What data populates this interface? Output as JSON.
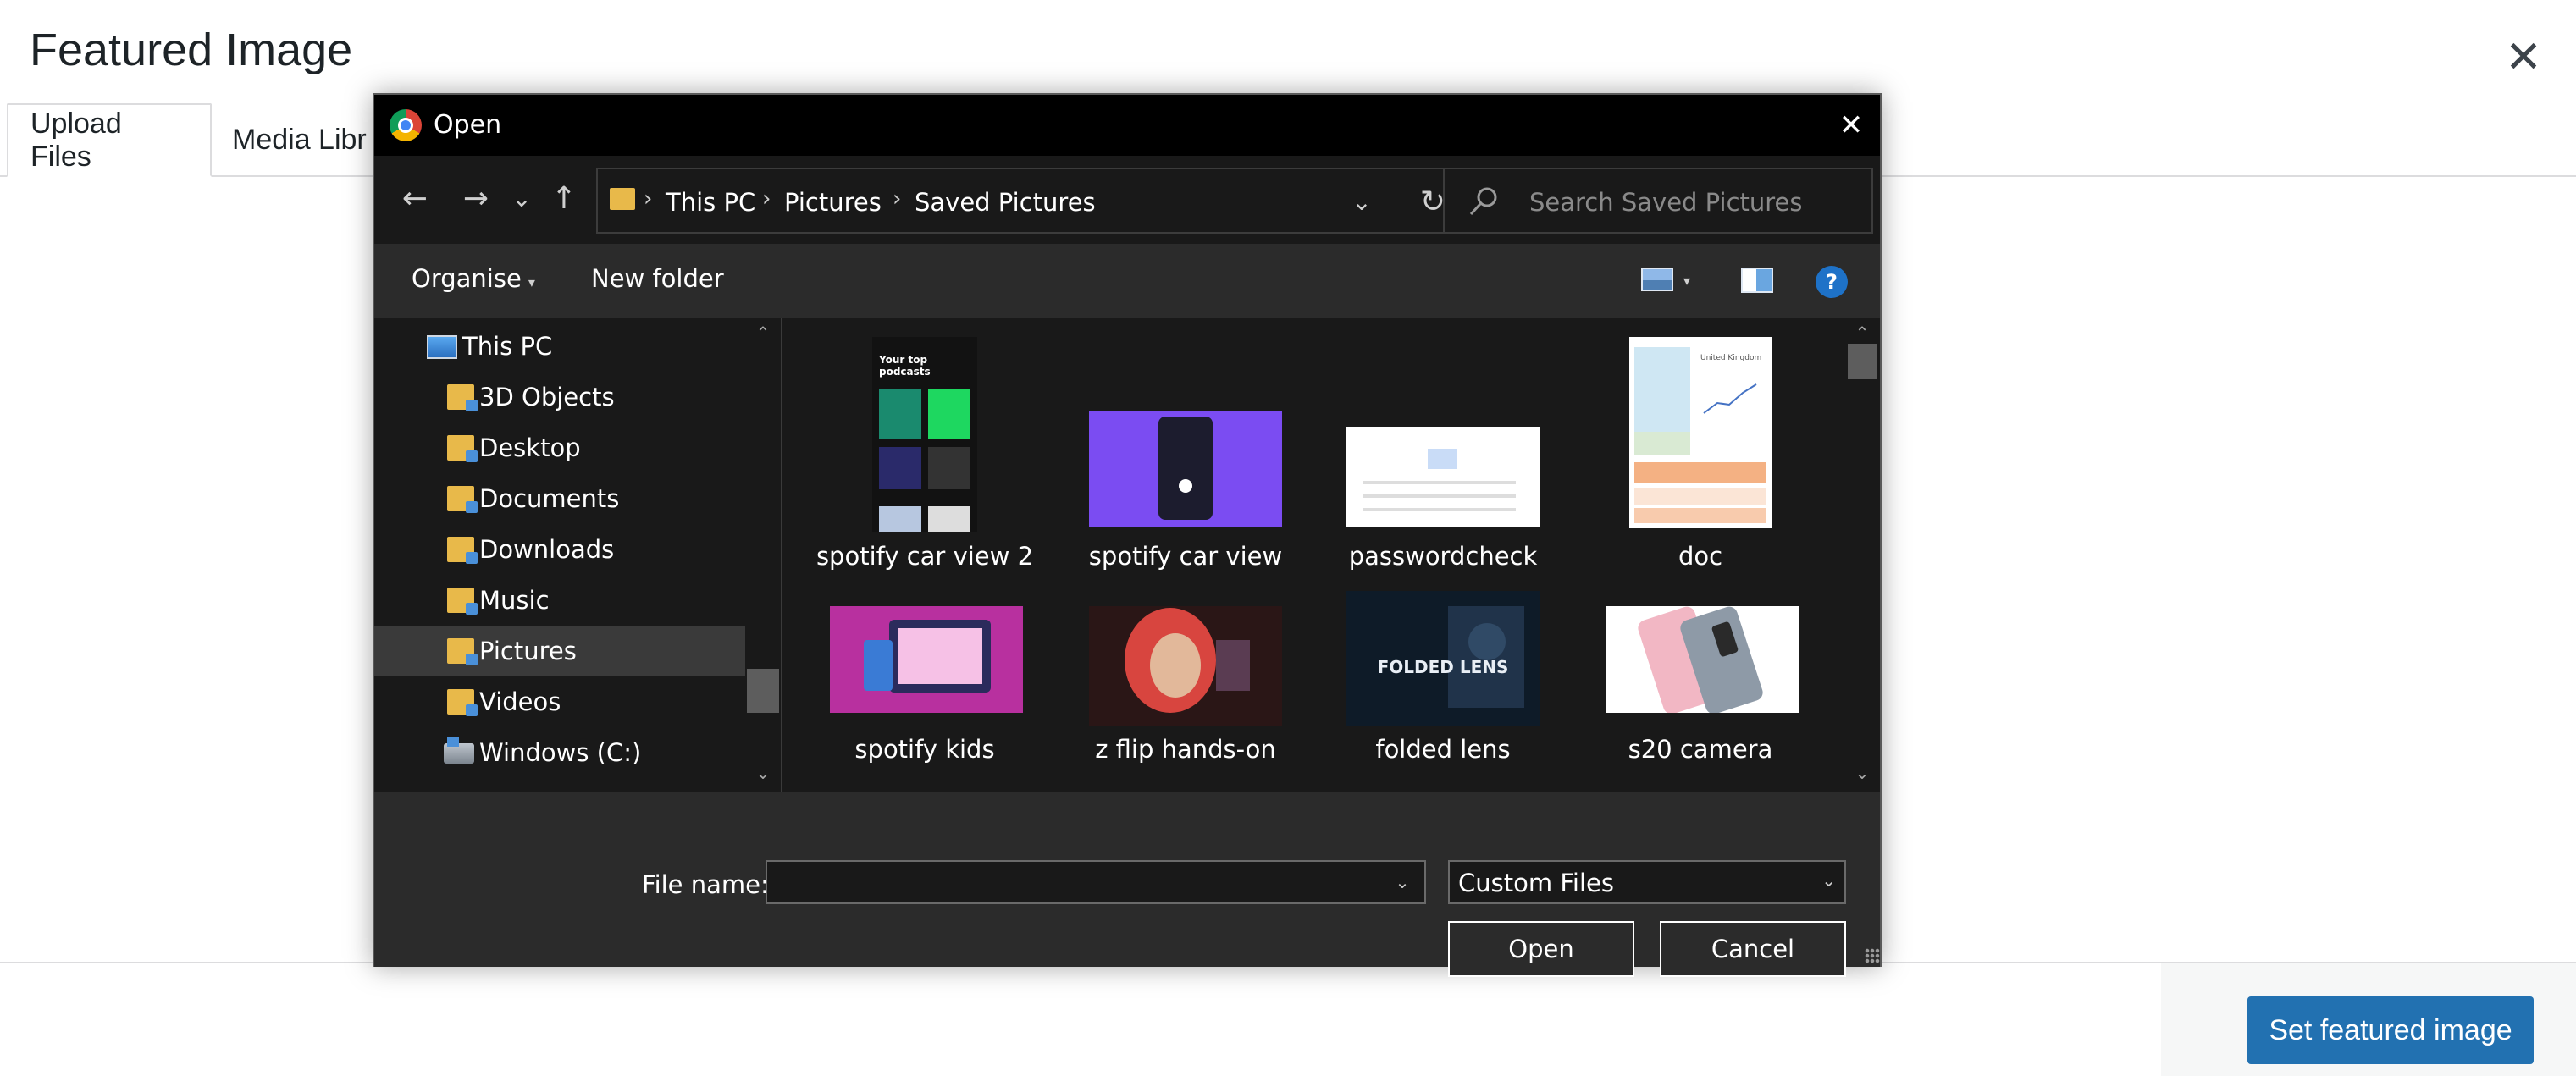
{
  "wp_modal": {
    "title": "Featured Image",
    "close_glyph": "✕",
    "tabs": [
      {
        "label": "Upload Files",
        "active": true
      },
      {
        "label": "Media Libr"
      }
    ],
    "primary_button": "Set featured image",
    "accent_color": "#2271b1"
  },
  "dialog": {
    "title": "Open",
    "app_icon": "chrome-icon",
    "close_glyph": "✕",
    "nav": {
      "back_glyph": "←",
      "forward_glyph": "→",
      "recent_glyph": "⌄",
      "up_glyph": "↑",
      "breadcrumbs": [
        "This PC",
        "Pictures",
        "Saved Pictures"
      ],
      "separator_glyph": "›",
      "dropdown_glyph": "⌄",
      "refresh_glyph": "↻"
    },
    "search": {
      "placeholder": "Search Saved Pictures"
    },
    "toolbar": {
      "organise": "Organise",
      "new_folder": "New folder",
      "caret_glyph": "▾",
      "help_glyph": "?"
    },
    "tree": [
      {
        "label": "This PC",
        "icon": "computer-icon"
      },
      {
        "label": "3D Objects",
        "icon": "folder-icon"
      },
      {
        "label": "Desktop",
        "icon": "folder-icon"
      },
      {
        "label": "Documents",
        "icon": "folder-icon"
      },
      {
        "label": "Downloads",
        "icon": "folder-icon"
      },
      {
        "label": "Music",
        "icon": "folder-icon"
      },
      {
        "label": "Pictures",
        "icon": "folder-icon",
        "selected": true
      },
      {
        "label": "Videos",
        "icon": "folder-icon"
      },
      {
        "label": "Windows (C:)",
        "icon": "drive-icon"
      }
    ],
    "files": [
      {
        "name": "spotify car view 2",
        "thumb_text": "Your top podcasts"
      },
      {
        "name": "spotify car view"
      },
      {
        "name": "passwordcheck"
      },
      {
        "name": "doc",
        "thumb_text": "United Kingdom"
      },
      {
        "name": "spotify kids"
      },
      {
        "name": "z flip hands-on"
      },
      {
        "name": "folded lens",
        "thumb_text": "FOLDED LENS"
      },
      {
        "name": "s20 camera"
      }
    ],
    "scroll_up_glyph": "⌃",
    "scroll_down_glyph": "⌄",
    "file_name_label": "File name:",
    "file_name_value": "",
    "file_name_caret": "⌄",
    "file_type": "Custom Files",
    "file_type_caret": "⌄",
    "open_button": "Open",
    "cancel_button": "Cancel"
  }
}
